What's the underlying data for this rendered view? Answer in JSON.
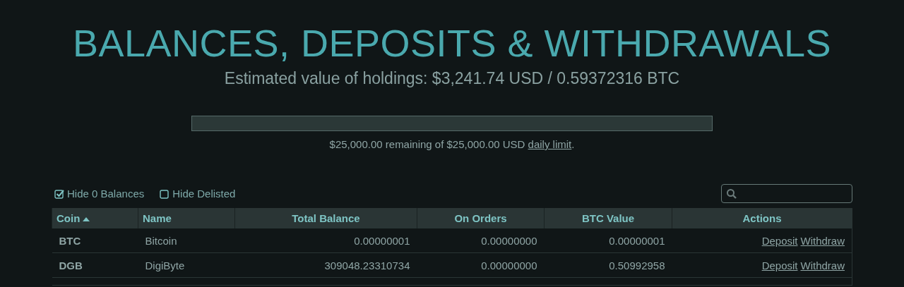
{
  "title": "BALANCES, DEPOSITS & WITHDRAWALS",
  "estimate": "Estimated value of holdings: $3,241.74 USD / 0.59372316 BTC",
  "limit": {
    "text": "$25,000.00 remaining of $25,000.00 USD",
    "link": "daily limit",
    "tail": "."
  },
  "filters": [
    {
      "label": "Hide 0 Balances",
      "checked": true
    },
    {
      "label": "Hide Delisted",
      "checked": false
    }
  ],
  "table": {
    "columns": [
      {
        "label": "Coin",
        "sorted": true
      },
      {
        "label": "Name",
        "sorted": false
      },
      {
        "label": "Total Balance",
        "sorted": false
      },
      {
        "label": "On Orders",
        "sorted": false
      },
      {
        "label": "BTC Value",
        "sorted": false
      },
      {
        "label": "Actions",
        "sorted": false
      }
    ],
    "rows": [
      {
        "coin": "BTC",
        "name": "Bitcoin",
        "total": "0.00000001",
        "orders": "0.00000000",
        "btc": "0.00000001",
        "actions": [
          "Deposit",
          "Withdraw"
        ]
      },
      {
        "coin": "DGB",
        "name": "DigiByte",
        "total": "309048.23310734",
        "orders": "0.00000000",
        "btc": "0.50992958",
        "actions": [
          "Deposit",
          "Withdraw"
        ]
      }
    ]
  }
}
